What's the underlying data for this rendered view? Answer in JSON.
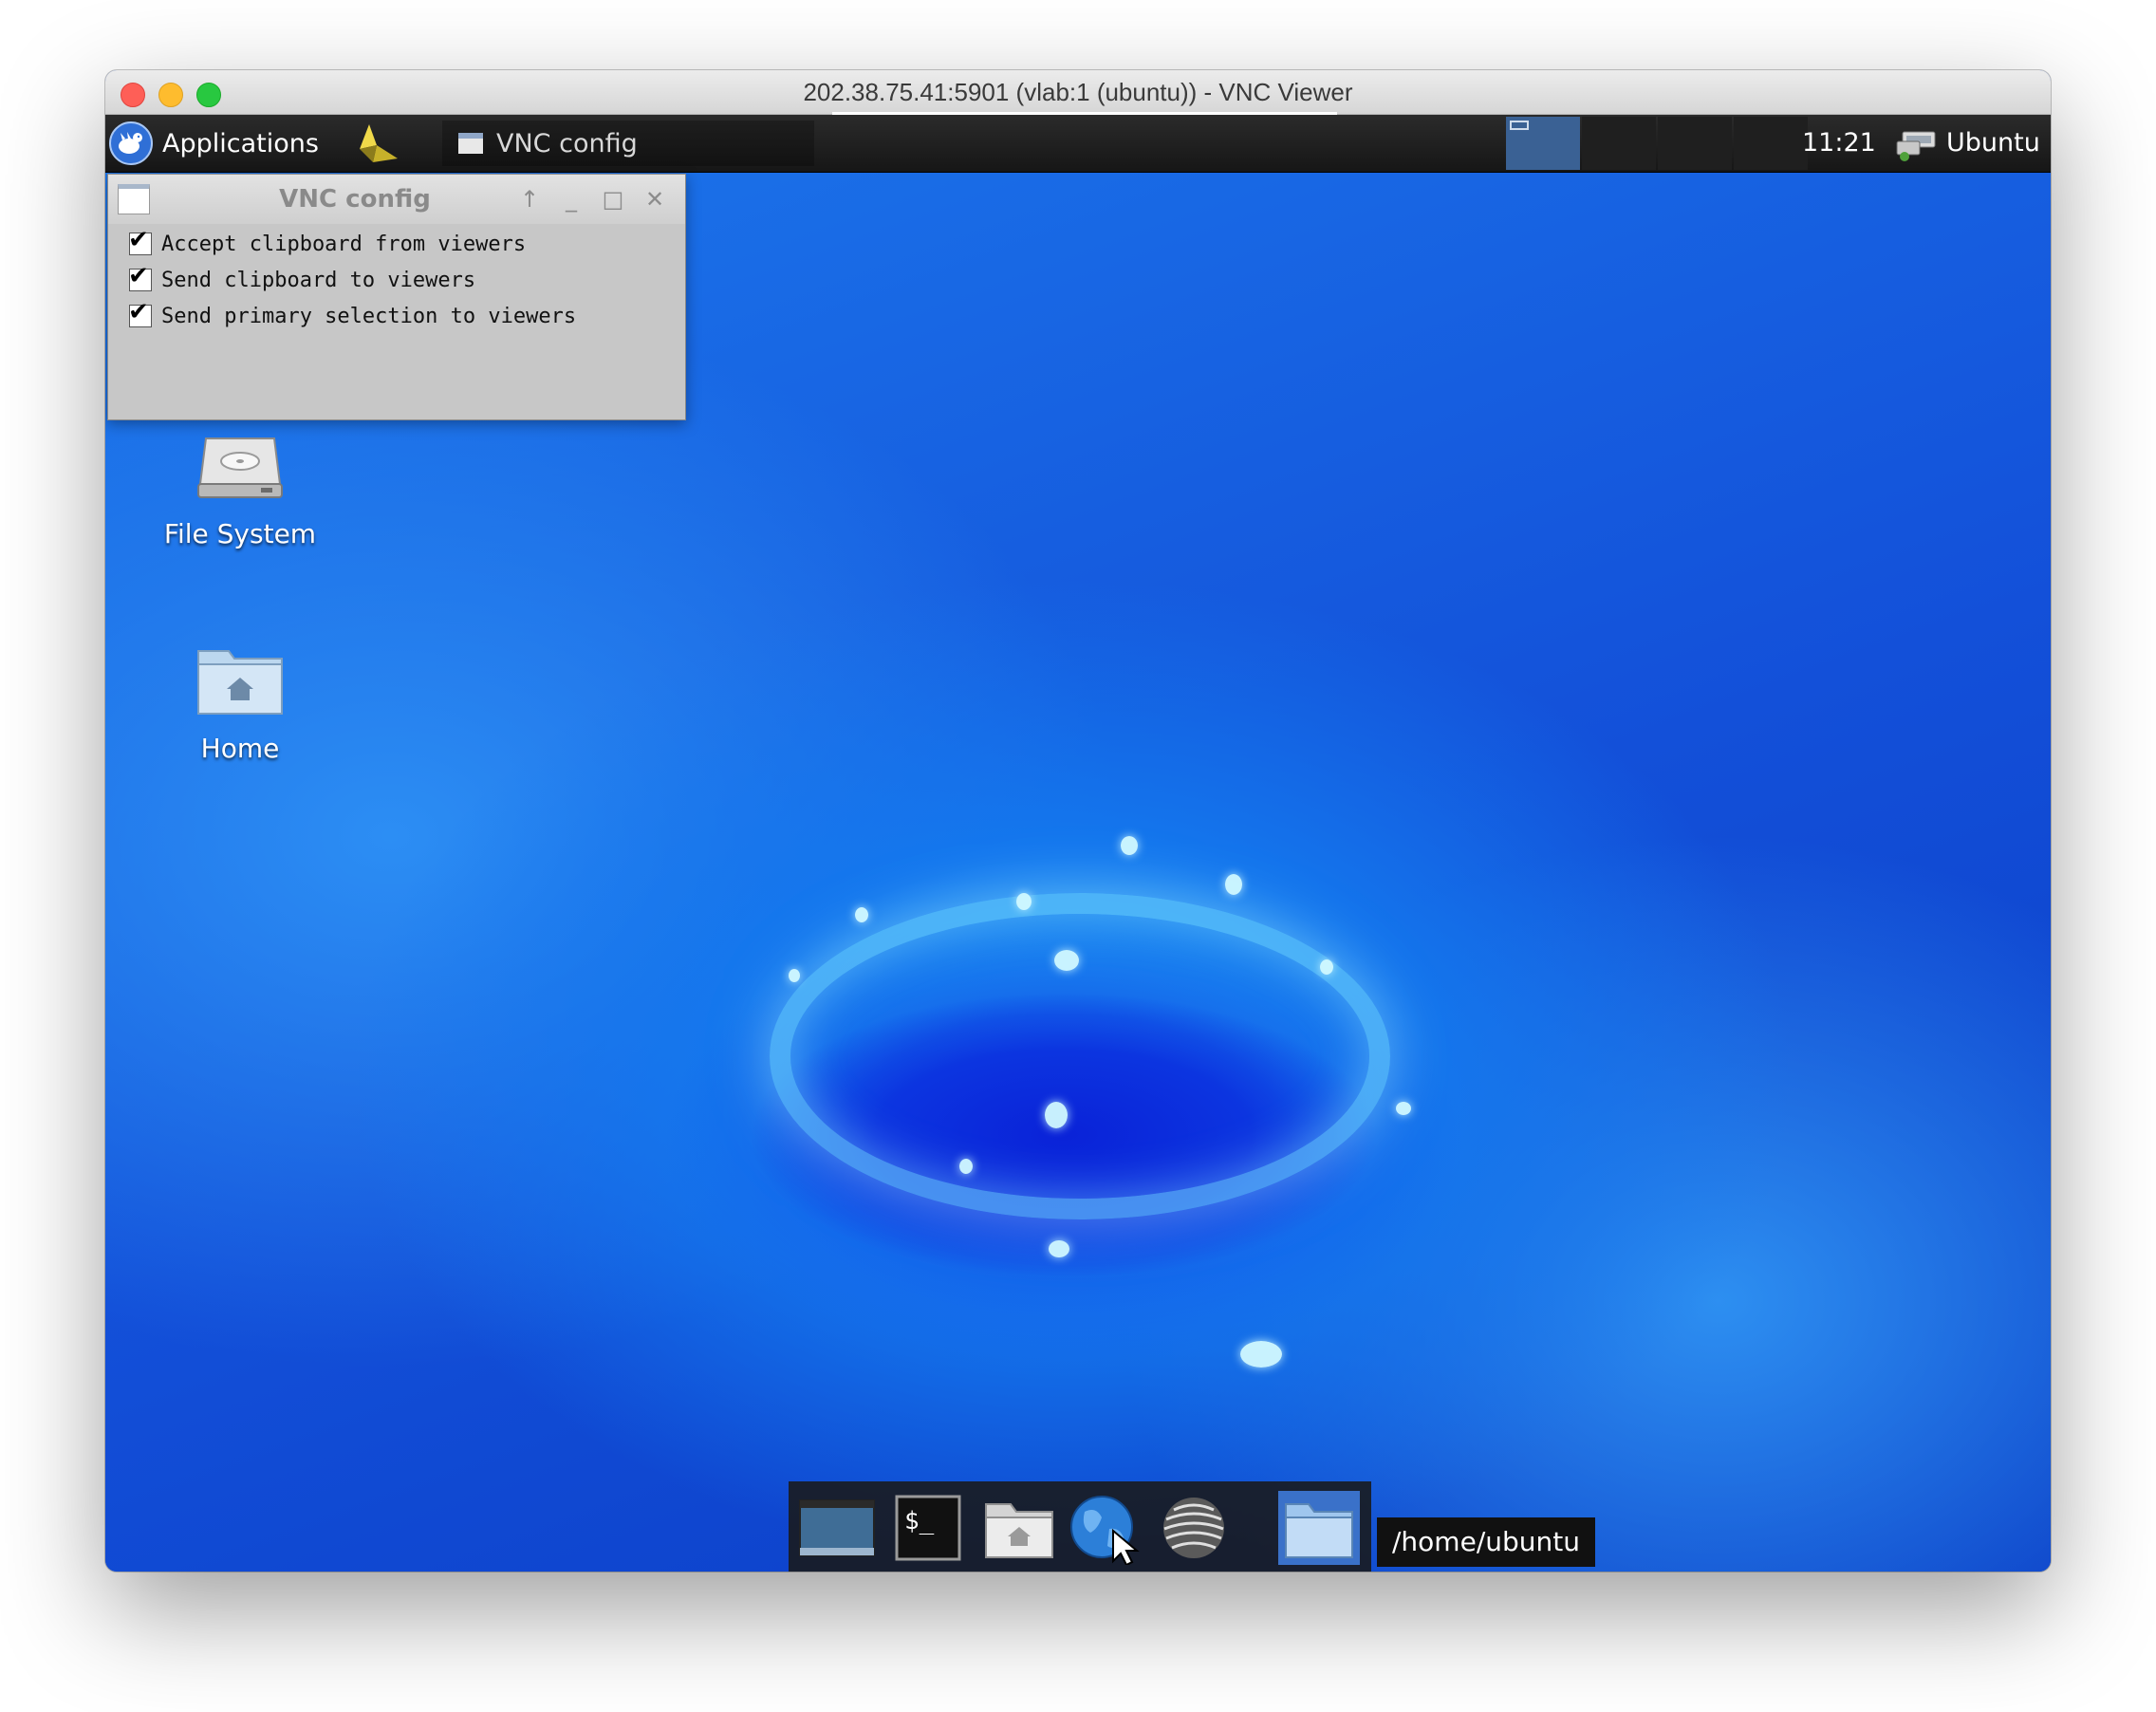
{
  "window": {
    "title": "202.38.75.41:5901 (vlab:1 (ubuntu)) - VNC Viewer"
  },
  "panel": {
    "applications_label": "Applications",
    "taskbar_item": "VNC config",
    "clock": "11:21",
    "user": "Ubuntu"
  },
  "dialog": {
    "title": "VNC config",
    "options": [
      {
        "label": "Accept clipboard from viewers",
        "checked": true
      },
      {
        "label": "Send clipboard to viewers",
        "checked": true
      },
      {
        "label": "Send primary selection to viewers",
        "checked": true
      }
    ],
    "check_mark": "✔"
  },
  "desktop": {
    "icons": [
      {
        "label": "File System",
        "icon": "hard-drive-icon"
      },
      {
        "label": "Home",
        "icon": "home-folder-icon"
      }
    ]
  },
  "dock": {
    "items": [
      "show-desktop-icon",
      "terminal-icon",
      "home-folder-icon",
      "web-browser-icon",
      "app-finder-icon",
      "folder-icon"
    ],
    "terminal_prompt": "$_",
    "tooltip": "/home/ubuntu"
  },
  "colors": {
    "panel_bg": "#1e1e1e",
    "active_workspace": "#3a6194",
    "dialog_bg": "#c7c7c7",
    "wallpaper_blue": "#1c78ec",
    "dock_active": "#3a71c9"
  }
}
